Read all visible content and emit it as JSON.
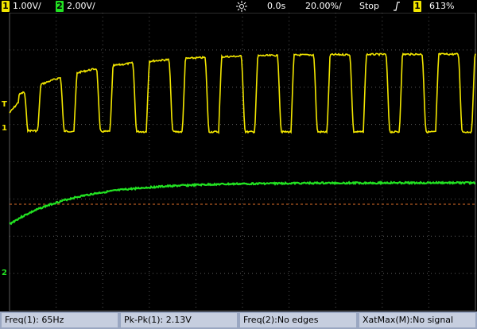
{
  "topbar": {
    "ch1_number": "1",
    "ch1_scale": "1.00V/",
    "ch2_number": "2",
    "ch2_scale": "2.00V/",
    "time_delay": "0.0s",
    "time_scale": "20.00%/",
    "run_state": "Stop",
    "trigger_channel": "1",
    "trigger_level": "613%"
  },
  "markers": {
    "ch1": "1",
    "ch2": "2",
    "trigger": "T"
  },
  "measurements": [
    {
      "label": "Freq(1): 65Hz"
    },
    {
      "label": "Pk-Pk(1): 2.13V"
    },
    {
      "label": "Freq(2):No edges"
    },
    {
      "label": "XatMax(M):No signal"
    }
  ],
  "colors": {
    "ch1": "#f2e600",
    "ch2": "#22e222",
    "grid": "#5a5a5a",
    "ref_line": "#e0702a",
    "meas_bg": "#c6cedf",
    "meas_bar": "#9aa7c2"
  },
  "icons": {
    "acquisition": "sun-icon",
    "trigger_edge": "rising-edge-icon"
  }
}
